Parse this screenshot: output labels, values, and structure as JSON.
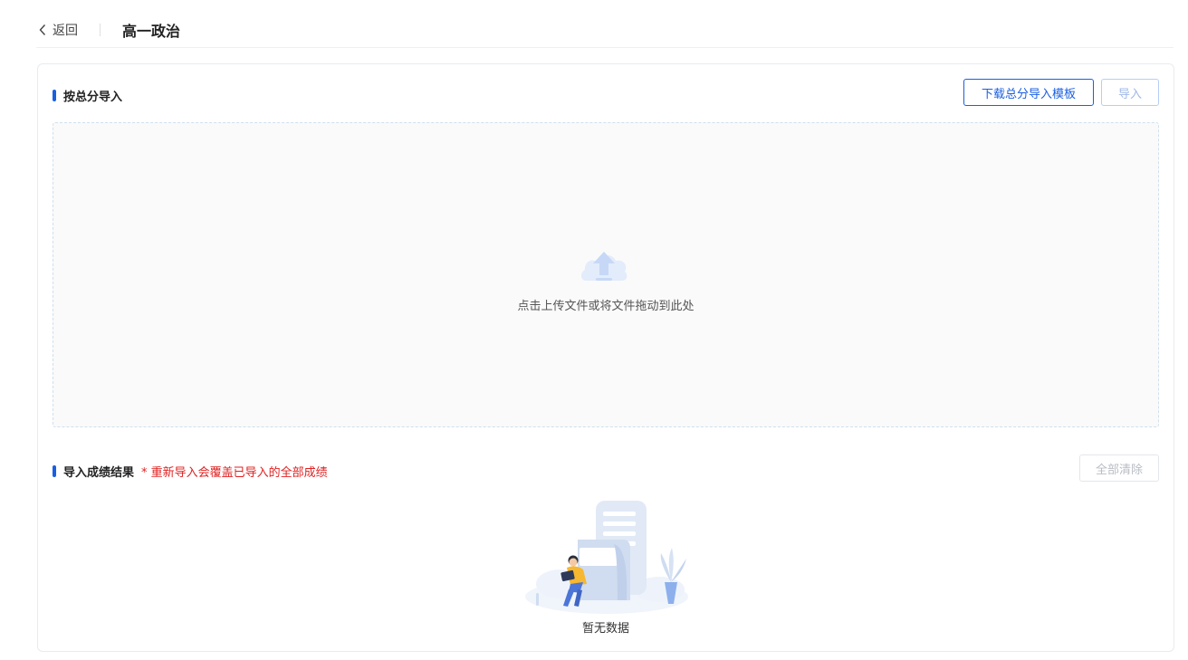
{
  "header": {
    "back_label": "返回",
    "title": "高一政治"
  },
  "import_section": {
    "title": "按总分导入",
    "download_template_label": "下载总分导入模板",
    "import_label": "导入",
    "dropzone_hint": "点击上传文件或将文件拖动到此处"
  },
  "result_section": {
    "title": "导入成绩结果",
    "warning": "* 重新导入会覆盖已导入的全部成绩",
    "clear_all_label": "全部清除",
    "empty_text": "暂无数据"
  },
  "colors": {
    "accent": "#1a5fe0",
    "warning": "#e02020",
    "border": "#e8ebf0"
  },
  "icons": {
    "back": "chevron-left-icon",
    "upload": "upload-cloud-icon",
    "empty": "empty-state-illustration"
  }
}
